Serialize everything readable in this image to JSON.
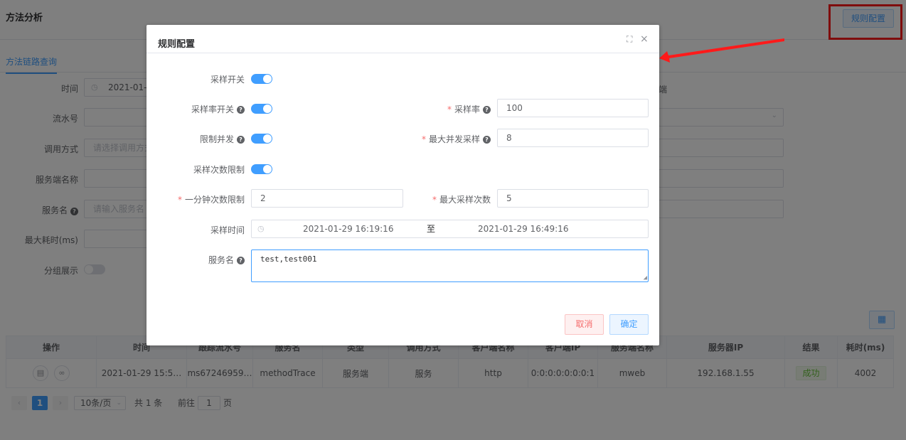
{
  "page": {
    "title": "方法分析",
    "rule_button": "规则配置",
    "tab": "方法链路查询"
  },
  "filters": {
    "time_label": "时间",
    "time_value": "2021-01-29 16:19:16",
    "serial_label": "流水号",
    "call_label": "调用方式",
    "call_placeholder": "请选择调用方式",
    "server_label": "服务端名称",
    "service_label": "服务名",
    "service_placeholder": "请输入服务名",
    "maxtime_label": "最大耗时(ms)",
    "group_label": "分组展示",
    "right_text_tail": "端"
  },
  "table": {
    "headers": [
      "操作",
      "时间",
      "跟踪流水号",
      "服务名",
      "类型",
      "调用方式",
      "客户端名称",
      "客户端IP",
      "服务端名称",
      "服务器IP",
      "结果",
      "耗时(ms)"
    ],
    "rows": [
      {
        "time": "2021-01-29 15:5…",
        "trace": "ms67246959…",
        "service": "methodTrace",
        "type": "服务端",
        "call": "服务",
        "client_name": "http",
        "client_ip": "0:0:0:0:0:0:0:1",
        "server_name": "mweb",
        "server_ip": "192.168.1.55",
        "result": "成功",
        "cost": "4002"
      }
    ]
  },
  "pagination": {
    "current": "1",
    "page_size": "10条/页",
    "total": "共 1 条",
    "goto_prefix": "前往",
    "goto_value": "1",
    "goto_suffix": "页"
  },
  "dialog": {
    "title": "规则配置",
    "sample_switch_label": "采样开关",
    "rate_switch_label": "采样率开关",
    "rate_label": "采样率",
    "rate_value": "100",
    "concurrency_switch_label": "限制并发",
    "max_concurrency_label": "最大并发采样",
    "max_concurrency_value": "8",
    "count_switch_label": "采样次数限制",
    "per_minute_label": "一分钟次数限制",
    "per_minute_value": "2",
    "max_count_label": "最大采样次数",
    "max_count_value": "5",
    "time_label": "采样时间",
    "time_start": "2021-01-29 16:19:16",
    "time_separator": "至",
    "time_end": "2021-01-29 16:49:16",
    "service_label": "服务名",
    "service_value": "test,test001",
    "cancel": "取消",
    "confirm": "确定"
  },
  "colors": {
    "primary": "#409eff",
    "danger": "#f56c6c",
    "success": "#67c23a",
    "annotation": "#ff1a1a"
  }
}
